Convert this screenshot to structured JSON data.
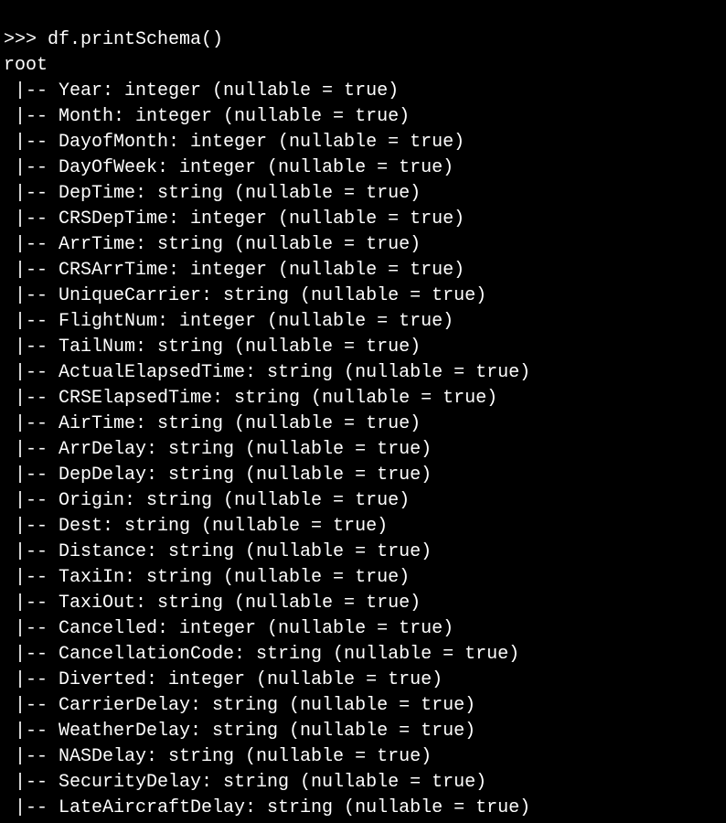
{
  "prompt": ">>> df.printSchema()",
  "root": "root",
  "fields": [
    {
      "name": "Year",
      "type": "integer",
      "nullable": "true"
    },
    {
      "name": "Month",
      "type": "integer",
      "nullable": "true"
    },
    {
      "name": "DayofMonth",
      "type": "integer",
      "nullable": "true"
    },
    {
      "name": "DayOfWeek",
      "type": "integer",
      "nullable": "true"
    },
    {
      "name": "DepTime",
      "type": "string",
      "nullable": "true"
    },
    {
      "name": "CRSDepTime",
      "type": "integer",
      "nullable": "true"
    },
    {
      "name": "ArrTime",
      "type": "string",
      "nullable": "true"
    },
    {
      "name": "CRSArrTime",
      "type": "integer",
      "nullable": "true"
    },
    {
      "name": "UniqueCarrier",
      "type": "string",
      "nullable": "true"
    },
    {
      "name": "FlightNum",
      "type": "integer",
      "nullable": "true"
    },
    {
      "name": "TailNum",
      "type": "string",
      "nullable": "true"
    },
    {
      "name": "ActualElapsedTime",
      "type": "string",
      "nullable": "true"
    },
    {
      "name": "CRSElapsedTime",
      "type": "string",
      "nullable": "true"
    },
    {
      "name": "AirTime",
      "type": "string",
      "nullable": "true"
    },
    {
      "name": "ArrDelay",
      "type": "string",
      "nullable": "true"
    },
    {
      "name": "DepDelay",
      "type": "string",
      "nullable": "true"
    },
    {
      "name": "Origin",
      "type": "string",
      "nullable": "true"
    },
    {
      "name": "Dest",
      "type": "string",
      "nullable": "true"
    },
    {
      "name": "Distance",
      "type": "string",
      "nullable": "true"
    },
    {
      "name": "TaxiIn",
      "type": "string",
      "nullable": "true"
    },
    {
      "name": "TaxiOut",
      "type": "string",
      "nullable": "true"
    },
    {
      "name": "Cancelled",
      "type": "integer",
      "nullable": "true"
    },
    {
      "name": "CancellationCode",
      "type": "string",
      "nullable": "true"
    },
    {
      "name": "Diverted",
      "type": "integer",
      "nullable": "true"
    },
    {
      "name": "CarrierDelay",
      "type": "string",
      "nullable": "true"
    },
    {
      "name": "WeatherDelay",
      "type": "string",
      "nullable": "true"
    },
    {
      "name": "NASDelay",
      "type": "string",
      "nullable": "true"
    },
    {
      "name": "SecurityDelay",
      "type": "string",
      "nullable": "true"
    },
    {
      "name": "LateAircraftDelay",
      "type": "string",
      "nullable": "true"
    }
  ]
}
